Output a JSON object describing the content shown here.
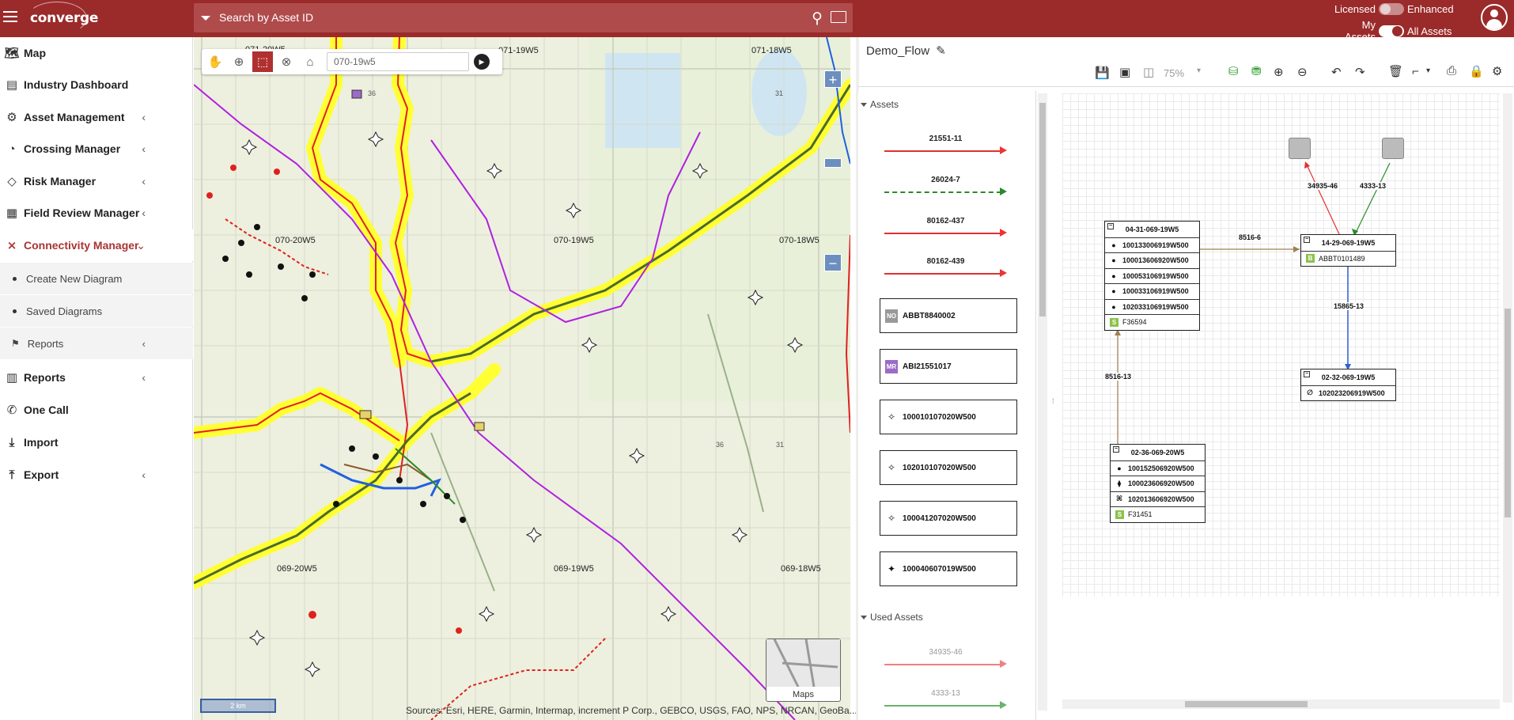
{
  "header": {
    "logo": "converge",
    "search_placeholder": "Search by Asset ID",
    "licensed_label": "Licensed",
    "enhanced_label": "Enhanced",
    "my_assets_label": "My Assets",
    "all_assets_label": "All Assets"
  },
  "sidebar": {
    "items": [
      {
        "label": "Map",
        "icon": "map-icon"
      },
      {
        "label": "Industry Dashboard",
        "icon": "dashboard-icon"
      },
      {
        "label": "Asset Management",
        "icon": "asset-icon"
      },
      {
        "label": "Crossing Manager",
        "icon": "crossing-icon"
      },
      {
        "label": "Risk Manager",
        "icon": "risk-icon"
      },
      {
        "label": "Field Review Manager",
        "icon": "field-review-icon"
      },
      {
        "label": "Connectivity Manager",
        "icon": "connectivity-icon"
      },
      {
        "label": "Reports",
        "icon": "reports-icon"
      },
      {
        "label": "One Call",
        "icon": "phone-icon"
      },
      {
        "label": "Import",
        "icon": "import-icon"
      },
      {
        "label": "Export",
        "icon": "export-icon"
      }
    ],
    "sub_items": [
      "Create New Diagram",
      "Saved Diagrams"
    ],
    "sub_reports": "Reports"
  },
  "map": {
    "search_value": "070-19w5",
    "grid_labels": [
      "071-20W5",
      "071-19W5",
      "071-18W5",
      "070-20W5",
      "070-19W5",
      "070-18W5",
      "069-20W5",
      "069-19W5",
      "069-18W5"
    ],
    "township_sections": [
      "36",
      "31",
      "36",
      "31"
    ],
    "scale": "2 km",
    "credits": "Sources: Esri, HERE, Garmin, Intermap, increment P Corp., GEBCO, USGS, FAO, NPS, NRCAN, GeoBa...",
    "minimap_label": "Maps",
    "zoom_in": "+",
    "zoom_out": "−"
  },
  "diagram": {
    "title": "Demo_Flow",
    "zoom": "75%",
    "palette": {
      "assets_section": "Assets",
      "used_assets_section": "Used Assets",
      "edges": [
        {
          "label": "21551-11",
          "color": "#e03030",
          "style": "solid"
        },
        {
          "label": "26024-7",
          "color": "#2a8a2a",
          "style": "dashed"
        },
        {
          "label": "80162-437",
          "color": "#e03030",
          "style": "solid"
        },
        {
          "label": "80162-439",
          "color": "#e03030",
          "style": "solid"
        }
      ],
      "nodes": [
        {
          "label": "ABBT8840002",
          "badge": "NO",
          "badge_color": "#999999"
        },
        {
          "label": "ABI21551017",
          "badge": "MR",
          "badge_color": "#9b6bc8"
        },
        {
          "label": "100010107020W500",
          "icon": "diamond-star-icon"
        },
        {
          "label": "102010107020W500",
          "icon": "diamond-star-icon"
        },
        {
          "label": "100041207020W500",
          "icon": "diamond-star-icon"
        },
        {
          "label": "100040607019W500",
          "icon": "filled-star-icon"
        }
      ],
      "used_edges": [
        {
          "label": "34935-46",
          "color": "#f08080"
        },
        {
          "label": "4333-13",
          "color": "#6ab36a"
        }
      ]
    },
    "cards": {
      "c1": {
        "title": "04-31-069-19W5",
        "rows": [
          "100133006919W500",
          "100013606920W500",
          "100053106919W500",
          "100033106919W500",
          "102033106919W500"
        ],
        "footer": "F36594",
        "footer_badge": "S"
      },
      "c2": {
        "title": "14-29-069-19W5",
        "rows": [
          "ABBT0101489"
        ],
        "row_badge": "B"
      },
      "c3": {
        "title": "02-32-069-19W5",
        "rows": [
          "102023206919W500"
        ]
      },
      "c4": {
        "title": "02-36-069-20W5",
        "rows": [
          "100152506920W500",
          "100023606920W500",
          "102013606920W500"
        ],
        "footer": "F31451",
        "footer_badge": "S"
      }
    },
    "edges": {
      "e1": "34935-46",
      "e2": "4333-13",
      "e3": "8516-6",
      "e4": "15865-13",
      "e5": "8516-13"
    }
  }
}
